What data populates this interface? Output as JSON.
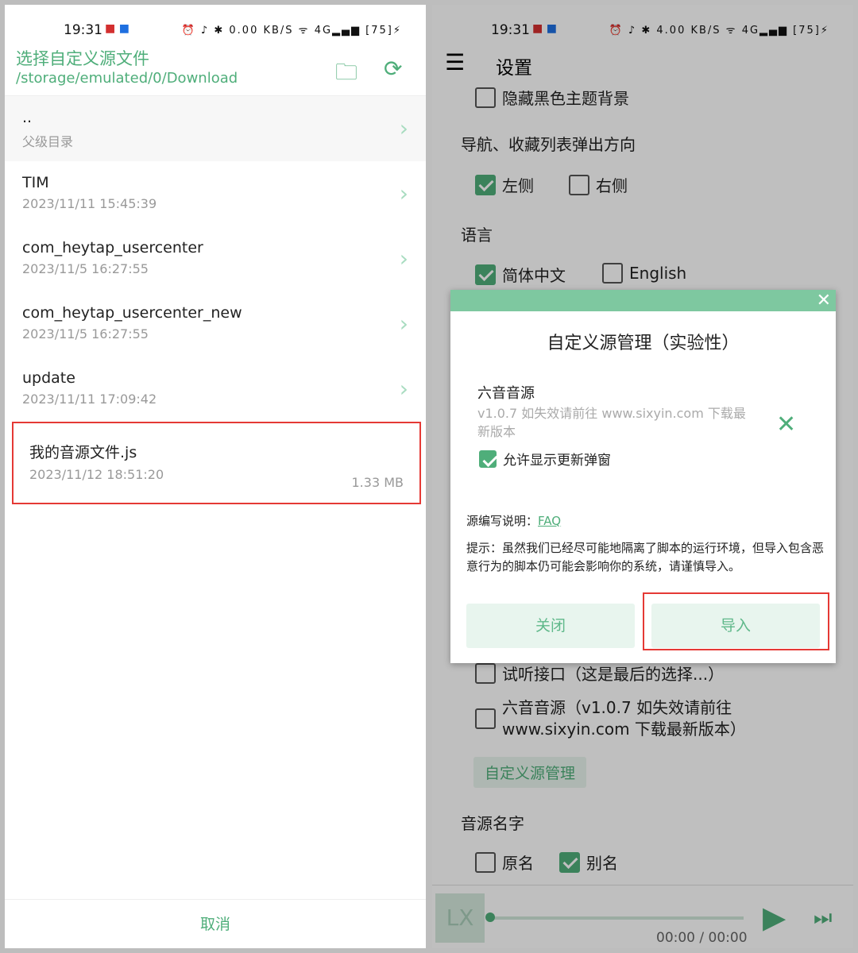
{
  "status": {
    "time": "19:31",
    "net": "0.00 KB/S",
    "net_right": "4.00 KB/S",
    "battery": "75",
    "signal": "4G"
  },
  "picker": {
    "title": "选择自定义源文件",
    "path": "/storage/emulated/0/Download",
    "cancel": "取消",
    "items": [
      {
        "name": "..",
        "date": "父级目录"
      },
      {
        "name": "TIM",
        "date": "2023/11/11 15:45:39"
      },
      {
        "name": "com_heytap_usercenter",
        "date": "2023/11/5 16:27:55"
      },
      {
        "name": "com_heytap_usercenter_new",
        "date": "2023/11/5 16:27:55"
      },
      {
        "name": "update",
        "date": "2023/11/11 17:09:42"
      },
      {
        "name": "我的音源文件.js",
        "date": "2023/11/12 18:51:20",
        "size": "1.33 MB"
      }
    ]
  },
  "settings": {
    "title": "设置",
    "hide_black": "隐藏黑色主题背景",
    "nav_dir": "导航、收藏列表弹出方向",
    "left": "左侧",
    "right": "右侧",
    "lang": "语言",
    "zh": "简体中文",
    "en": "English",
    "trial": "试听接口（这是最后的选择...）",
    "source_line1": "六音音源（v1.0.7 如失效请前往",
    "source_line2": "www.sixyin.com 下载最新版本）",
    "manage_btn": "自定义源管理",
    "name_label": "音源名字",
    "orig": "原名",
    "alias": "别名"
  },
  "player": {
    "logo": "LX",
    "time": "00:00 / 00:00",
    "progress": 0
  },
  "dialog": {
    "title": "自定义源管理（实验性）",
    "source_name": "六音音源",
    "source_desc": "v1.0.7 如失效请前往 www.sixyin.com 下载最新版本",
    "allow_update": "允许显示更新弹窗",
    "faq_label": "源编写说明：",
    "faq": "FAQ",
    "tip": "提示：虽然我们已经尽可能地隔离了脚本的运行环境，但导入包含恶意行为的脚本仍可能会影响你的系统，请谨慎导入。",
    "close": "关闭",
    "import": "导入"
  },
  "colors": {
    "accent": "#4fae7a",
    "highlight": "#e53935"
  }
}
